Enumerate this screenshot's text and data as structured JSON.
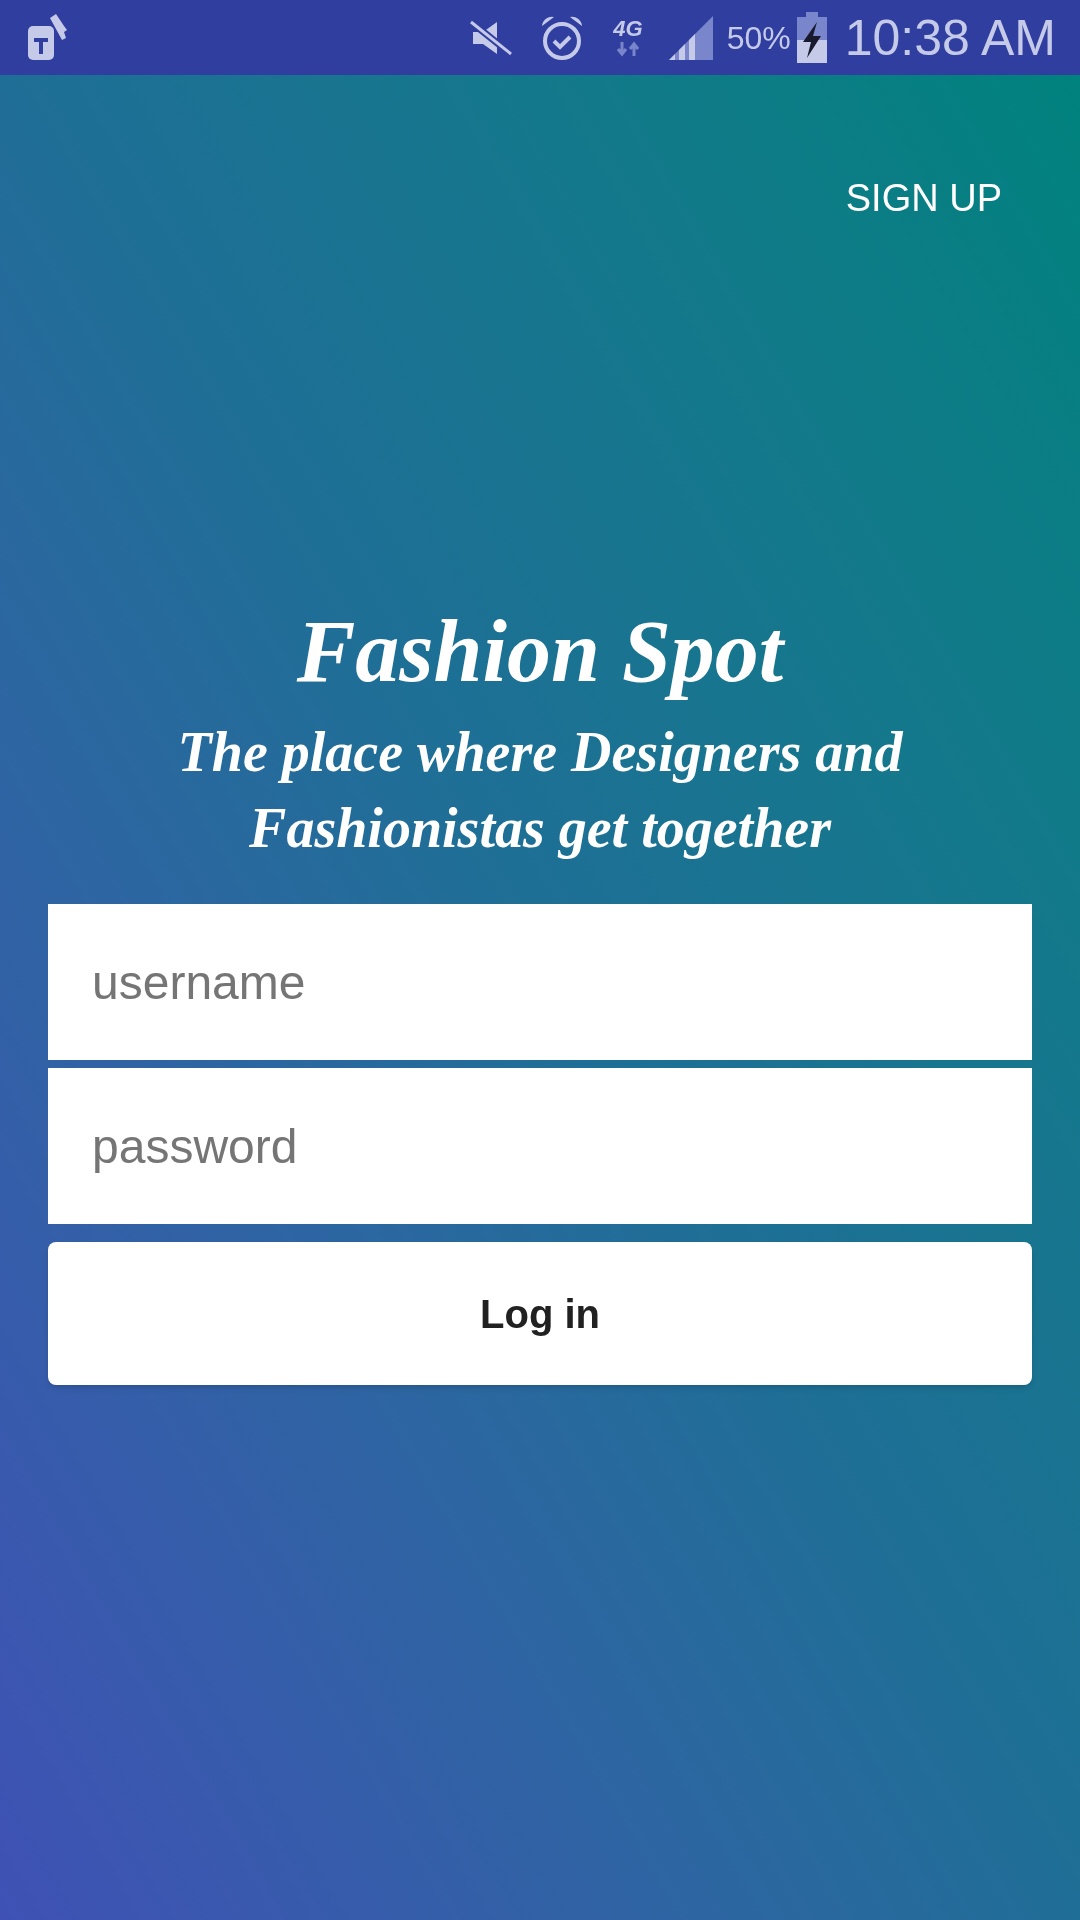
{
  "status_bar": {
    "network_type": "4G",
    "battery": "50%",
    "time": "10:38 AM"
  },
  "sign_up": "SIGN UP",
  "title": "Fashion Spot",
  "tagline": "The place where Designers and Fashionistas get together",
  "username": {
    "placeholder": "username"
  },
  "password": {
    "placeholder": "password"
  },
  "login_button": "Log in"
}
